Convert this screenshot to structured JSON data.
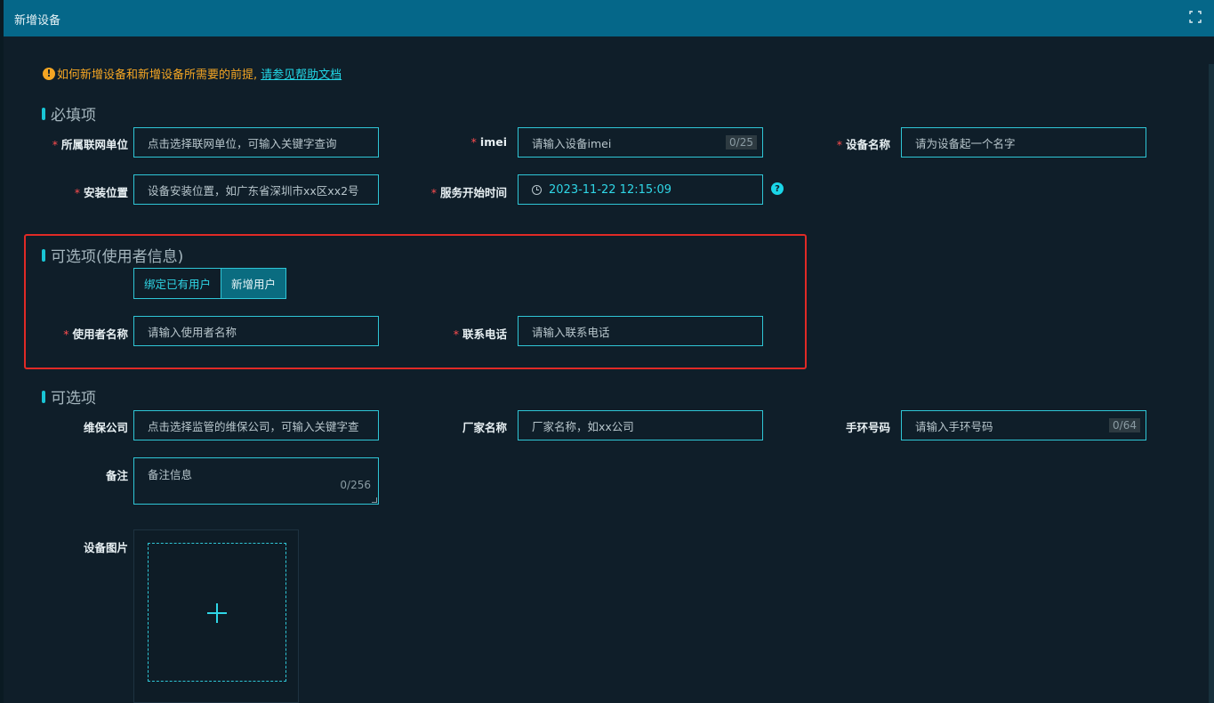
{
  "dialog": {
    "title": "新增设备"
  },
  "tip": {
    "icon": "!",
    "text": "如何新增设备和新增设备所需要的前提,",
    "link": "请参见帮助文档"
  },
  "required": {
    "title": "必填项",
    "unit_label": "所属联网单位",
    "unit_placeholder": "点击选择联网单位，可输入关键字查询",
    "imei_label": "imei",
    "imei_placeholder": "请输入设备imei",
    "imei_counter": "0/25",
    "name_label": "设备名称",
    "name_placeholder": "请为设备起一个名字",
    "location_label": "安装位置",
    "location_placeholder": "设备安装位置，如广东省深圳市xx区xx2号",
    "start_label": "服务开始时间",
    "start_value": "2023-11-22 12:15:09",
    "help_icon": "?"
  },
  "user": {
    "title": "可选项(使用者信息)",
    "bind_label": "绑定已有用户",
    "new_label": "新增用户",
    "username_label": "使用者名称",
    "username_placeholder": "请输入使用者名称",
    "phone_label": "联系电话",
    "phone_placeholder": "请输入联系电话"
  },
  "optional": {
    "title": "可选项",
    "company_label": "维保公司",
    "company_placeholder": "点击选择监管的维保公司，可输入关键字查",
    "vendor_label": "厂家名称",
    "vendor_placeholder": "厂家名称，如xx公司",
    "band_label": "手环号码",
    "band_placeholder": "请输入手环号码",
    "band_counter": "0/64",
    "remark_label": "备注",
    "remark_placeholder": "备注信息",
    "remark_counter": "0/256",
    "image_label": "设备图片"
  },
  "colors": {
    "accent": "#2fc6d6",
    "titlebar": "#056789",
    "warning": "#f5a623",
    "highlight_box": "#e02a26"
  }
}
